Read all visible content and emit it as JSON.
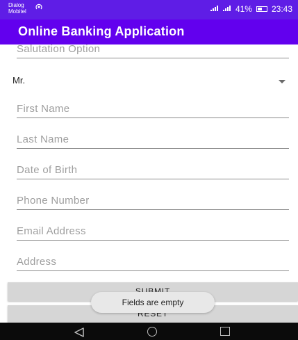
{
  "status_bar": {
    "carrier_line1": "Dialog",
    "carrier_line2": "Mobitel",
    "hotspot_icon": "hotspot-icon",
    "signal_icon": "signal-icon",
    "battery_percent": "41%",
    "battery_icon": "battery-icon",
    "battery_level": 0.41,
    "time": "23:43"
  },
  "app_bar": {
    "title": "Online Banking Application"
  },
  "form": {
    "salutation_placeholder": "Salutation Option",
    "salutation_value": "Mr.",
    "first_name_placeholder": "First Name",
    "last_name_placeholder": "Last Name",
    "dob_placeholder": "Date of Birth",
    "phone_placeholder": "Phone Number",
    "email_placeholder": "Email Address",
    "address_placeholder": "Address"
  },
  "buttons": {
    "submit": "SUBMIT",
    "reset": "RESET"
  },
  "toast": {
    "message": "Fields are empty"
  },
  "nav_bar": {
    "back_icon": "back-icon",
    "home_icon": "home-icon",
    "recent_icon": "recent-apps-icon"
  },
  "colors": {
    "status_bar": "#5f1de6",
    "app_bar": "#6200ee",
    "button": "#d6d6d6",
    "nav_bar": "#0b0b0b"
  }
}
